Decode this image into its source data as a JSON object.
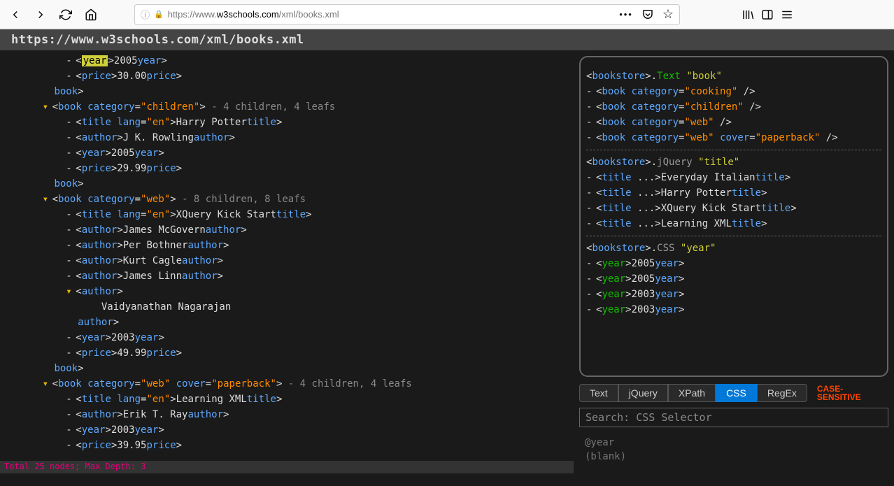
{
  "url_display_host": "w3schools.com",
  "url_display_prefix": "https://www.",
  "url_display_path": "/xml/books.xml",
  "header_url": "https://www.w3schools.com/xml/books.xml",
  "xml_tree": [
    {
      "indent": 3,
      "kind": "bullet",
      "tokens": [
        [
          "punct",
          "<"
        ],
        [
          "hl",
          "year"
        ],
        [
          "punct",
          ">"
        ],
        [
          "text",
          "2005"
        ],
        [
          "punct",
          "</"
        ],
        [
          "tag",
          "year"
        ],
        [
          "punct",
          ">"
        ]
      ]
    },
    {
      "indent": 3,
      "kind": "bullet",
      "tokens": [
        [
          "punct",
          "<"
        ],
        [
          "tag",
          "price"
        ],
        [
          "punct",
          ">"
        ],
        [
          "text",
          "30.00"
        ],
        [
          "punct",
          "</"
        ],
        [
          "tag",
          "price"
        ],
        [
          "punct",
          ">"
        ]
      ]
    },
    {
      "indent": 2,
      "kind": "none",
      "tokens": [
        [
          "punct",
          "</"
        ],
        [
          "tag",
          "book"
        ],
        [
          "punct",
          ">"
        ]
      ]
    },
    {
      "indent": 2,
      "kind": "arrow",
      "tokens": [
        [
          "punct",
          "<"
        ],
        [
          "tag",
          "book"
        ],
        [
          "punct",
          " "
        ],
        [
          "attr",
          "category"
        ],
        [
          "punct",
          "="
        ],
        [
          "val",
          "\"children\""
        ],
        [
          "punct",
          ">"
        ],
        [
          "meta",
          " - 4 children, 4 leafs"
        ]
      ]
    },
    {
      "indent": 3,
      "kind": "bullet",
      "tokens": [
        [
          "punct",
          "<"
        ],
        [
          "tag",
          "title"
        ],
        [
          "punct",
          " "
        ],
        [
          "attr",
          "lang"
        ],
        [
          "punct",
          "="
        ],
        [
          "val",
          "\"en\""
        ],
        [
          "punct",
          ">"
        ],
        [
          "text",
          "Harry Potter"
        ],
        [
          "punct",
          "</"
        ],
        [
          "tag",
          "title"
        ],
        [
          "punct",
          ">"
        ]
      ]
    },
    {
      "indent": 3,
      "kind": "bullet",
      "tokens": [
        [
          "punct",
          "<"
        ],
        [
          "tag",
          "author"
        ],
        [
          "punct",
          ">"
        ],
        [
          "text",
          "J K. Rowling"
        ],
        [
          "punct",
          "</"
        ],
        [
          "tag",
          "author"
        ],
        [
          "punct",
          ">"
        ]
      ]
    },
    {
      "indent": 3,
      "kind": "bullet",
      "tokens": [
        [
          "punct",
          "<"
        ],
        [
          "tag",
          "year"
        ],
        [
          "punct",
          ">"
        ],
        [
          "text",
          "2005"
        ],
        [
          "punct",
          "</"
        ],
        [
          "tag",
          "year"
        ],
        [
          "punct",
          ">"
        ]
      ]
    },
    {
      "indent": 3,
      "kind": "bullet",
      "tokens": [
        [
          "punct",
          "<"
        ],
        [
          "tag",
          "price"
        ],
        [
          "punct",
          ">"
        ],
        [
          "text",
          "29.99"
        ],
        [
          "punct",
          "</"
        ],
        [
          "tag",
          "price"
        ],
        [
          "punct",
          ">"
        ]
      ]
    },
    {
      "indent": 2,
      "kind": "none",
      "tokens": [
        [
          "punct",
          "</"
        ],
        [
          "tag",
          "book"
        ],
        [
          "punct",
          ">"
        ]
      ]
    },
    {
      "indent": 2,
      "kind": "arrow",
      "tokens": [
        [
          "punct",
          "<"
        ],
        [
          "tag",
          "book"
        ],
        [
          "punct",
          " "
        ],
        [
          "attr",
          "category"
        ],
        [
          "punct",
          "="
        ],
        [
          "val",
          "\"web\""
        ],
        [
          "punct",
          ">"
        ],
        [
          "meta",
          " - 8 children, 8 leafs"
        ]
      ]
    },
    {
      "indent": 3,
      "kind": "bullet",
      "tokens": [
        [
          "punct",
          "<"
        ],
        [
          "tag",
          "title"
        ],
        [
          "punct",
          " "
        ],
        [
          "attr",
          "lang"
        ],
        [
          "punct",
          "="
        ],
        [
          "val",
          "\"en\""
        ],
        [
          "punct",
          ">"
        ],
        [
          "text",
          "XQuery Kick Start"
        ],
        [
          "punct",
          "</"
        ],
        [
          "tag",
          "title"
        ],
        [
          "punct",
          ">"
        ]
      ]
    },
    {
      "indent": 3,
      "kind": "bullet",
      "tokens": [
        [
          "punct",
          "<"
        ],
        [
          "tag",
          "author"
        ],
        [
          "punct",
          ">"
        ],
        [
          "text",
          "James McGovern"
        ],
        [
          "punct",
          "</"
        ],
        [
          "tag",
          "author"
        ],
        [
          "punct",
          ">"
        ]
      ]
    },
    {
      "indent": 3,
      "kind": "bullet",
      "tokens": [
        [
          "punct",
          "<"
        ],
        [
          "tag",
          "author"
        ],
        [
          "punct",
          ">"
        ],
        [
          "text",
          "Per Bothner"
        ],
        [
          "punct",
          "</"
        ],
        [
          "tag",
          "author"
        ],
        [
          "punct",
          ">"
        ]
      ]
    },
    {
      "indent": 3,
      "kind": "bullet",
      "tokens": [
        [
          "punct",
          "<"
        ],
        [
          "tag",
          "author"
        ],
        [
          "punct",
          ">"
        ],
        [
          "text",
          "Kurt Cagle"
        ],
        [
          "punct",
          "</"
        ],
        [
          "tag",
          "author"
        ],
        [
          "punct",
          ">"
        ]
      ]
    },
    {
      "indent": 3,
      "kind": "bullet",
      "tokens": [
        [
          "punct",
          "<"
        ],
        [
          "tag",
          "author"
        ],
        [
          "punct",
          ">"
        ],
        [
          "text",
          "James Linn"
        ],
        [
          "punct",
          "</"
        ],
        [
          "tag",
          "author"
        ],
        [
          "punct",
          ">"
        ]
      ]
    },
    {
      "indent": 3,
      "kind": "arrow",
      "tokens": [
        [
          "punct",
          "<"
        ],
        [
          "tag",
          "author"
        ],
        [
          "punct",
          ">"
        ]
      ]
    },
    {
      "indent": 4,
      "kind": "none",
      "tokens": [
        [
          "text",
          "Vaidyanathan Nagarajan"
        ]
      ]
    },
    {
      "indent": 3,
      "kind": "none",
      "tokens": [
        [
          "punct",
          "</"
        ],
        [
          "tag",
          "author"
        ],
        [
          "punct",
          ">"
        ]
      ]
    },
    {
      "indent": 3,
      "kind": "bullet",
      "tokens": [
        [
          "punct",
          "<"
        ],
        [
          "tag",
          "year"
        ],
        [
          "punct",
          ">"
        ],
        [
          "text",
          "2003"
        ],
        [
          "punct",
          "</"
        ],
        [
          "tag",
          "year"
        ],
        [
          "punct",
          ">"
        ]
      ]
    },
    {
      "indent": 3,
      "kind": "bullet",
      "tokens": [
        [
          "punct",
          "<"
        ],
        [
          "tag",
          "price"
        ],
        [
          "punct",
          ">"
        ],
        [
          "text",
          "49.99"
        ],
        [
          "punct",
          "</"
        ],
        [
          "tag",
          "price"
        ],
        [
          "punct",
          ">"
        ]
      ]
    },
    {
      "indent": 2,
      "kind": "none",
      "tokens": [
        [
          "punct",
          "</"
        ],
        [
          "tag",
          "book"
        ],
        [
          "punct",
          ">"
        ]
      ]
    },
    {
      "indent": 2,
      "kind": "arrow",
      "tokens": [
        [
          "punct",
          "<"
        ],
        [
          "tag",
          "book"
        ],
        [
          "punct",
          " "
        ],
        [
          "attr",
          "category"
        ],
        [
          "punct",
          "="
        ],
        [
          "val",
          "\"web\""
        ],
        [
          "punct",
          " "
        ],
        [
          "attr",
          "cover"
        ],
        [
          "punct",
          "="
        ],
        [
          "val",
          "\"paperback\""
        ],
        [
          "punct",
          ">"
        ],
        [
          "meta",
          " - 4 children, 4 leafs"
        ]
      ]
    },
    {
      "indent": 3,
      "kind": "bullet",
      "tokens": [
        [
          "punct",
          "<"
        ],
        [
          "tag",
          "title"
        ],
        [
          "punct",
          " "
        ],
        [
          "attr",
          "lang"
        ],
        [
          "punct",
          "="
        ],
        [
          "val",
          "\"en\""
        ],
        [
          "punct",
          ">"
        ],
        [
          "text",
          "Learning XML"
        ],
        [
          "punct",
          "</"
        ],
        [
          "tag",
          "title"
        ],
        [
          "punct",
          ">"
        ]
      ]
    },
    {
      "indent": 3,
      "kind": "bullet",
      "tokens": [
        [
          "punct",
          "<"
        ],
        [
          "tag",
          "author"
        ],
        [
          "punct",
          ">"
        ],
        [
          "text",
          "Erik T. Ray"
        ],
        [
          "punct",
          "</"
        ],
        [
          "tag",
          "author"
        ],
        [
          "punct",
          ">"
        ]
      ]
    },
    {
      "indent": 3,
      "kind": "bullet",
      "tokens": [
        [
          "punct",
          "<"
        ],
        [
          "tag",
          "year"
        ],
        [
          "punct",
          ">"
        ],
        [
          "text",
          "2003"
        ],
        [
          "punct",
          "</"
        ],
        [
          "tag",
          "year"
        ],
        [
          "punct",
          ">"
        ]
      ]
    },
    {
      "indent": 3,
      "kind": "bullet",
      "tokens": [
        [
          "punct",
          "<"
        ],
        [
          "tag",
          "price"
        ],
        [
          "punct",
          ">"
        ],
        [
          "text",
          "39.95"
        ],
        [
          "punct",
          "</"
        ],
        [
          "tag",
          "price"
        ],
        [
          "punct",
          ">"
        ]
      ]
    }
  ],
  "results_sections": [
    {
      "header": [
        [
          "punct",
          "<"
        ],
        [
          "tag",
          "bookstore"
        ],
        [
          "punct",
          ">."
        ],
        [
          "sel",
          "Text"
        ],
        [
          "punct",
          " "
        ],
        [
          "q",
          "\"book\""
        ]
      ],
      "items": [
        [
          [
            "punct",
            "<"
          ],
          [
            "tag",
            "book"
          ],
          [
            "punct",
            " "
          ],
          [
            "attr",
            "category"
          ],
          [
            "punct",
            "="
          ],
          [
            "val",
            "\"cooking\""
          ],
          [
            "punct",
            " />"
          ]
        ],
        [
          [
            "punct",
            "<"
          ],
          [
            "tag",
            "book"
          ],
          [
            "punct",
            " "
          ],
          [
            "attr",
            "category"
          ],
          [
            "punct",
            "="
          ],
          [
            "val",
            "\"children\""
          ],
          [
            "punct",
            " />"
          ]
        ],
        [
          [
            "punct",
            "<"
          ],
          [
            "tag",
            "book"
          ],
          [
            "punct",
            " "
          ],
          [
            "attr",
            "category"
          ],
          [
            "punct",
            "="
          ],
          [
            "val",
            "\"web\""
          ],
          [
            "punct",
            " />"
          ]
        ],
        [
          [
            "punct",
            "<"
          ],
          [
            "tag",
            "book"
          ],
          [
            "punct",
            " "
          ],
          [
            "attr",
            "category"
          ],
          [
            "punct",
            "="
          ],
          [
            "val",
            "\"web\""
          ],
          [
            "punct",
            " "
          ],
          [
            "attr",
            "cover"
          ],
          [
            "punct",
            "="
          ],
          [
            "val",
            "\"paperback\""
          ],
          [
            "punct",
            " />"
          ]
        ]
      ]
    },
    {
      "header": [
        [
          "punct",
          "<"
        ],
        [
          "tag",
          "bookstore"
        ],
        [
          "punct",
          ">."
        ],
        [
          "method",
          "jQuery"
        ],
        [
          "punct",
          " "
        ],
        [
          "q",
          "\"title\""
        ]
      ],
      "items": [
        [
          [
            "punct",
            "<"
          ],
          [
            "tag",
            "title"
          ],
          [
            "punct",
            " ...>"
          ],
          [
            "text",
            "Everyday Italian"
          ],
          [
            "punct",
            "</"
          ],
          [
            "tag",
            "title"
          ],
          [
            "punct",
            ">"
          ]
        ],
        [
          [
            "punct",
            "<"
          ],
          [
            "tag",
            "title"
          ],
          [
            "punct",
            " ...>"
          ],
          [
            "text",
            "Harry Potter"
          ],
          [
            "punct",
            "</"
          ],
          [
            "tag",
            "title"
          ],
          [
            "punct",
            ">"
          ]
        ],
        [
          [
            "punct",
            "<"
          ],
          [
            "tag",
            "title"
          ],
          [
            "punct",
            " ...>"
          ],
          [
            "text",
            "XQuery Kick Start"
          ],
          [
            "punct",
            "</"
          ],
          [
            "tag",
            "title"
          ],
          [
            "punct",
            ">"
          ]
        ],
        [
          [
            "punct",
            "<"
          ],
          [
            "tag",
            "title"
          ],
          [
            "punct",
            " ...>"
          ],
          [
            "text",
            "Learning XML"
          ],
          [
            "punct",
            "</"
          ],
          [
            "tag",
            "title"
          ],
          [
            "punct",
            ">"
          ]
        ]
      ]
    },
    {
      "header": [
        [
          "punct",
          "<"
        ],
        [
          "tag",
          "bookstore"
        ],
        [
          "punct",
          ">."
        ],
        [
          "method",
          "CSS"
        ],
        [
          "punct",
          " "
        ],
        [
          "q",
          "\"year\""
        ]
      ],
      "items": [
        [
          [
            "punct",
            "<"
          ],
          [
            "year",
            "year"
          ],
          [
            "punct",
            ">"
          ],
          [
            "text",
            "2005"
          ],
          [
            "punct",
            "</"
          ],
          [
            "tag",
            "year"
          ],
          [
            "punct",
            ">"
          ]
        ],
        [
          [
            "punct",
            "<"
          ],
          [
            "year",
            "year"
          ],
          [
            "punct",
            ">"
          ],
          [
            "text",
            "2005"
          ],
          [
            "punct",
            "</"
          ],
          [
            "tag",
            "year"
          ],
          [
            "punct",
            ">"
          ]
        ],
        [
          [
            "punct",
            "<"
          ],
          [
            "year",
            "year"
          ],
          [
            "punct",
            ">"
          ],
          [
            "text",
            "2003"
          ],
          [
            "punct",
            "</"
          ],
          [
            "tag",
            "year"
          ],
          [
            "punct",
            ">"
          ]
        ],
        [
          [
            "punct",
            "<"
          ],
          [
            "year",
            "year"
          ],
          [
            "punct",
            ">"
          ],
          [
            "text",
            "2003"
          ],
          [
            "punct",
            "</"
          ],
          [
            "tag",
            "year"
          ],
          [
            "punct",
            ">"
          ]
        ]
      ]
    }
  ],
  "tabs": [
    "Text",
    "jQuery",
    "XPath",
    "CSS",
    "RegEx"
  ],
  "active_tab": "CSS",
  "case_label": "CASE-\nSENSITIVE",
  "search_placeholder": "Search: CSS Selector",
  "history": [
    "@year",
    "(blank)"
  ],
  "status": "Total 25 nodes; Max Depth: 3"
}
